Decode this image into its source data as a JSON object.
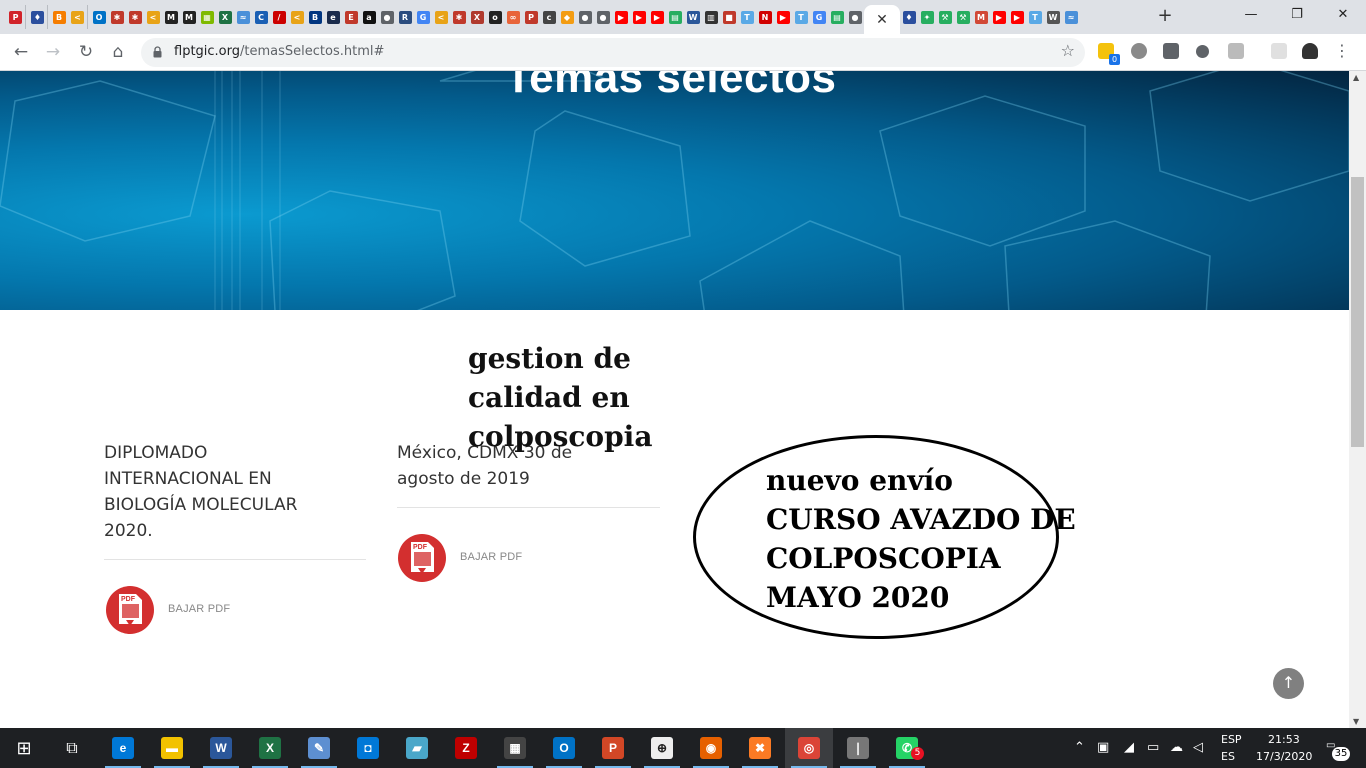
{
  "browser": {
    "url_domain": "flptgic.org",
    "url_path": "/temasSelectos.html#",
    "active_tab_close": "✕",
    "new_tab": "+",
    "window_controls": {
      "minimize": "—",
      "maximize": "❐",
      "close": "✕"
    },
    "nav": {
      "back": "←",
      "forward": "→",
      "reload": "↻",
      "home": "⌂"
    },
    "star": "☆",
    "extension_badge": "0",
    "tab_favicons": [
      {
        "icon": "pocket-icon",
        "color": "#d1232a",
        "glyph": "P"
      },
      {
        "icon": "shield-icon",
        "color": "#2b4f9e",
        "glyph": "♦"
      },
      {
        "icon": "blogger-icon",
        "color": "#f57d00",
        "glyph": "B"
      },
      {
        "icon": "bracket-icon",
        "color": "#e8a317",
        "glyph": "<"
      },
      {
        "icon": "outlook-icon",
        "color": "#0072c6",
        "glyph": "O"
      },
      {
        "icon": "spider-icon",
        "color": "#c0392b",
        "glyph": "✱"
      },
      {
        "icon": "spider-icon",
        "color": "#c0392b",
        "glyph": "✱"
      },
      {
        "icon": "bracket-icon",
        "color": "#e8a317",
        "glyph": "<"
      },
      {
        "icon": "book-icon",
        "color": "#222222",
        "glyph": "M"
      },
      {
        "icon": "book-icon",
        "color": "#222222",
        "glyph": "M"
      },
      {
        "icon": "microsoft-icon",
        "color": "#7fba00",
        "glyph": "▦"
      },
      {
        "icon": "excel-icon",
        "color": "#1f7244",
        "glyph": "X"
      },
      {
        "icon": "wifi-icon",
        "color": "#4a90d9",
        "glyph": "≈"
      },
      {
        "icon": "chrome-alt-icon",
        "color": "#1a5fb4",
        "glyph": "C"
      },
      {
        "icon": "scalpel-icon",
        "color": "#cc0000",
        "glyph": "/"
      },
      {
        "icon": "bracket-icon",
        "color": "#e8a317",
        "glyph": "<"
      },
      {
        "icon": "booking-icon",
        "color": "#003580",
        "glyph": "B"
      },
      {
        "icon": "app-icon",
        "color": "#1a2b4c",
        "glyph": "e"
      },
      {
        "icon": "e-icon",
        "color": "#c0392b",
        "glyph": "E"
      },
      {
        "icon": "amazon-icon",
        "color": "#111111",
        "glyph": "a"
      },
      {
        "icon": "globe-icon",
        "color": "#5f6368",
        "glyph": "●"
      },
      {
        "icon": "r-icon",
        "color": "#2b4c7e",
        "glyph": "R"
      },
      {
        "icon": "google-icon",
        "color": "#4285f4",
        "glyph": "G"
      },
      {
        "icon": "bracket-icon",
        "color": "#e8a317",
        "glyph": "<"
      },
      {
        "icon": "spider-icon",
        "color": "#c0392b",
        "glyph": "✱"
      },
      {
        "icon": "box-icon",
        "color": "#b03a2e",
        "glyph": "X"
      },
      {
        "icon": "circle-icon",
        "color": "#222222",
        "glyph": "o"
      },
      {
        "icon": "link-icon",
        "color": "#e8643a",
        "glyph": "∞"
      },
      {
        "icon": "pin-icon",
        "color": "#c0392b",
        "glyph": "P"
      },
      {
        "icon": "cc-icon",
        "color": "#444444",
        "glyph": "c"
      },
      {
        "icon": "orange-icon",
        "color": "#f39c12",
        "glyph": "◆"
      },
      {
        "icon": "globe-icon",
        "color": "#5f6368",
        "glyph": "●"
      },
      {
        "icon": "globe-icon",
        "color": "#5f6368",
        "glyph": "●"
      },
      {
        "icon": "youtube-icon",
        "color": "#ff0000",
        "glyph": "▶"
      },
      {
        "icon": "youtube-icon",
        "color": "#ff0000",
        "glyph": "▶"
      },
      {
        "icon": "youtube-icon",
        "color": "#ff0000",
        "glyph": "▶"
      },
      {
        "icon": "chart-icon",
        "color": "#27ae60",
        "glyph": "▤"
      },
      {
        "icon": "word-icon",
        "color": "#2b579a",
        "glyph": "W"
      },
      {
        "icon": "book-icon",
        "color": "#333333",
        "glyph": "▥"
      },
      {
        "icon": "doc-icon",
        "color": "#c0392b",
        "glyph": "■"
      },
      {
        "icon": "translate-icon",
        "color": "#5aa9e6",
        "glyph": "T"
      },
      {
        "icon": "n-icon",
        "color": "#d10000",
        "glyph": "N"
      },
      {
        "icon": "youtube-icon",
        "color": "#ff0000",
        "glyph": "▶"
      },
      {
        "icon": "translate-icon",
        "color": "#5aa9e6",
        "glyph": "T"
      },
      {
        "icon": "google-icon",
        "color": "#4285f4",
        "glyph": "G"
      },
      {
        "icon": "chart-icon",
        "color": "#27ae60",
        "glyph": "▤"
      },
      {
        "icon": "globe-icon",
        "color": "#5f6368",
        "glyph": "●"
      }
    ],
    "tab_favicons_right": [
      {
        "icon": "shield-icon",
        "color": "#2b4f9e",
        "glyph": "♦"
      },
      {
        "icon": "puzzle-icon",
        "color": "#27ae60",
        "glyph": "✦"
      },
      {
        "icon": "wrench-icon",
        "color": "#27ae60",
        "glyph": "⚒"
      },
      {
        "icon": "wrench-icon",
        "color": "#27ae60",
        "glyph": "⚒"
      },
      {
        "icon": "gmail-icon",
        "color": "#d14836",
        "glyph": "M"
      },
      {
        "icon": "youtube-icon",
        "color": "#ff0000",
        "glyph": "▶"
      },
      {
        "icon": "youtube-icon",
        "color": "#ff0000",
        "glyph": "▶"
      },
      {
        "icon": "translate-icon",
        "color": "#5aa9e6",
        "glyph": "T"
      },
      {
        "icon": "wikipedia-icon",
        "color": "#555555",
        "glyph": "W"
      },
      {
        "icon": "wifi-icon",
        "color": "#4a90d9",
        "glyph": "≈"
      }
    ]
  },
  "page": {
    "hero_title": "Temas selectos",
    "overlay_title": "gestion de calidad en colposcopia",
    "cards": [
      {
        "title": "DIPLOMADO INTERNACIONAL EN BIOLOGÍA MOLECULAR 2020.",
        "link": "BAJAR PDF",
        "pdf_label": "PDF"
      },
      {
        "title": "México, CDMX 30 de agosto de 2019",
        "link": "BAJAR PDF",
        "pdf_label": "PDF"
      }
    ],
    "oval_lines": [
      "nuevo envío",
      "CURSO AVAZDO DE",
      "COLPOSCOPIA",
      "MAYO 2020"
    ],
    "back_to_top": "↑"
  },
  "colors": {
    "accent": "#0477ad",
    "pdf_red": "#d32f2f",
    "taskbar": "#1e2023"
  },
  "taskbar": {
    "start": "⊞",
    "task_view": "⧉",
    "apps": [
      {
        "name": "edge-icon",
        "glyph": "e",
        "color": "#0078d7"
      },
      {
        "name": "file-explorer-icon",
        "glyph": "▬",
        "color": "#f2c200"
      },
      {
        "name": "word-icon",
        "glyph": "W",
        "color": "#2b579a"
      },
      {
        "name": "excel-icon",
        "glyph": "X",
        "color": "#1f7244"
      },
      {
        "name": "paint-icon",
        "glyph": "✎",
        "color": "#5d8fd1"
      },
      {
        "name": "store-icon",
        "glyph": "◘",
        "color": "#0078d7"
      },
      {
        "name": "notes-icon",
        "glyph": "▰",
        "color": "#4aa7c9"
      },
      {
        "name": "filezilla-icon",
        "glyph": "Z",
        "color": "#bf0000"
      },
      {
        "name": "calculator-icon",
        "glyph": "▦",
        "color": "#444444"
      },
      {
        "name": "outlook-icon",
        "glyph": "O",
        "color": "#0072c6"
      },
      {
        "name": "powerpoint-icon",
        "glyph": "P",
        "color": "#d24726"
      },
      {
        "name": "magnifier-icon",
        "glyph": "⊕",
        "color": "#eeeeee"
      },
      {
        "name": "firefox-icon",
        "glyph": "◉",
        "color": "#e66000"
      },
      {
        "name": "xampp-icon",
        "glyph": "✖",
        "color": "#fb7a24"
      },
      {
        "name": "chrome-icon",
        "glyph": "◎",
        "color": "#db4437"
      },
      {
        "name": "terminal-icon",
        "glyph": "❘",
        "color": "#777777"
      },
      {
        "name": "whatsapp-icon",
        "glyph": "✆",
        "color": "#25d366"
      }
    ],
    "whatsapp_badge": "5",
    "lang_top": "ESP",
    "lang_bottom": "ES",
    "time": "21:53",
    "date": "17/3/2020",
    "notifications": "35"
  }
}
